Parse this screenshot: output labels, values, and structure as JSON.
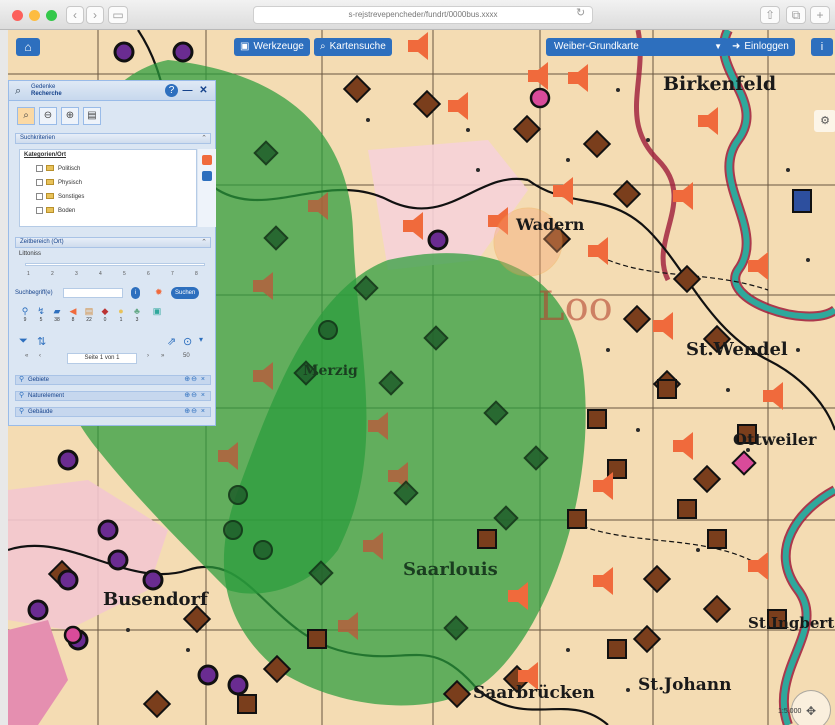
{
  "browser": {
    "url": "s-rejstrevepencheder/fundrt/0000bus.xxxx",
    "back": "‹",
    "forward": "›",
    "reload": "↻"
  },
  "toolbar": {
    "home_icon": "home-icon",
    "tools_label": "Werkzeuge",
    "map_search_label": "Kartensuche",
    "basemap_label": "Weiber-Grundkarte",
    "login_label": "Einloggen",
    "info_label": "i"
  },
  "panel": {
    "title_line1": "Gedenke",
    "title_line2": "Recherche",
    "help": "?",
    "minimize": "—",
    "close": "✕",
    "sections": {
      "search_criteria": "Suchkriterien",
      "time_range": "Zeitbereich (Ort)"
    },
    "categories": {
      "title": "Kategorien/Ort",
      "items": [
        "Politisch",
        "Physisch",
        "Sonstiges",
        "Boden"
      ]
    },
    "slider": {
      "label": "Littoniss",
      "ticks": [
        "1",
        "2",
        "3",
        "4",
        "5",
        "6",
        "7",
        "8"
      ]
    },
    "results": {
      "label": "Suchbegriff(e)",
      "search_button": "Suchen",
      "counts": [
        "9",
        "5",
        "38",
        "8",
        "22",
        "0",
        "1",
        "3"
      ]
    },
    "pager": {
      "page_text": "Seite 1 von 1",
      "per_page": "50"
    },
    "result_items": [
      "Gebiete",
      "Naturelement",
      "Gebäude"
    ]
  },
  "map": {
    "labels": [
      "Birkenfeld",
      "Wadern",
      "St.Wendel",
      "Ottweiler",
      "Saarlouis",
      "Busendorf",
      "St.Ingbert",
      "St.Johann",
      "Saarbrücken",
      "Merzig",
      "Loo"
    ]
  },
  "scale_text": "1:5.000",
  "colors": {
    "accent": "#2d6fbe",
    "map_base": "#f4dcb3",
    "overlay_green": "#2a9d3b",
    "river_teal": "#2fa89c",
    "border_red": "#9e1b3a",
    "marker_brown": "#7a3e1c",
    "marker_purple": "#6a2c91",
    "sound_orange": "#f06a3c"
  }
}
